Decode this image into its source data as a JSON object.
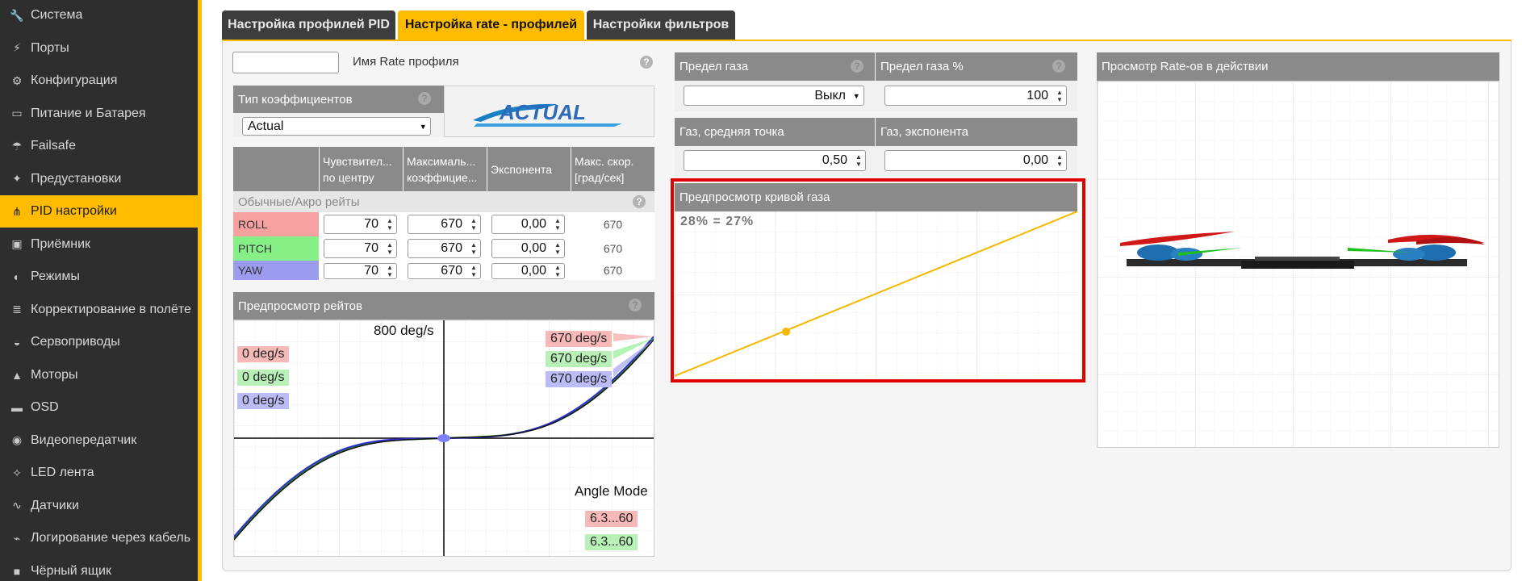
{
  "sidebar": {
    "items": [
      {
        "label": "Система",
        "icon": "wrench-icon"
      },
      {
        "label": "Порты",
        "icon": "plug-icon"
      },
      {
        "label": "Конфигурация",
        "icon": "gear-icon"
      },
      {
        "label": "Питание и Батарея",
        "icon": "battery-icon"
      },
      {
        "label": "Failsafe",
        "icon": "parachute-icon"
      },
      {
        "label": "Предустановки",
        "icon": "magic-wand-icon"
      },
      {
        "label": "PID настройки",
        "icon": "network-icon",
        "active": true
      },
      {
        "label": "Приёмник",
        "icon": "radio-icon"
      },
      {
        "label": "Режимы",
        "icon": "toggle-icon"
      },
      {
        "label": "Корректирование в полёте",
        "icon": "sliders-icon"
      },
      {
        "label": "Сервоприводы",
        "icon": "servo-icon"
      },
      {
        "label": "Моторы",
        "icon": "motor-icon"
      },
      {
        "label": "OSD",
        "icon": "osd-icon"
      },
      {
        "label": "Видеопередатчик",
        "icon": "broadcast-icon"
      },
      {
        "label": "LED лента",
        "icon": "led-icon"
      },
      {
        "label": "Датчики",
        "icon": "pulse-icon"
      },
      {
        "label": "Логирование через кабель",
        "icon": "cable-icon"
      },
      {
        "label": "Чёрный ящик",
        "icon": "blackbox-icon"
      }
    ]
  },
  "tabs": [
    {
      "label": "Настройка профилей PID"
    },
    {
      "label": "Настройка rate - профилей",
      "active": true
    },
    {
      "label": "Настройки фильтров"
    }
  ],
  "profile": {
    "name_value": "",
    "name_label": "Имя Rate профиля"
  },
  "coef": {
    "header": "Тип коэффициентов",
    "selected": "Actual",
    "logo_text": "ACTUAL"
  },
  "rates_table": {
    "columns": [
      "Чувствител... по центру",
      "Максималь... коэффицие...",
      "Экспонента",
      "Макс. скор. [град/сек]"
    ],
    "col_line1": [
      "Чувствител...",
      "Максималь...",
      "Экспонента",
      "Макс. скор."
    ],
    "col_line2": [
      "по центру",
      "коэффицие...",
      "",
      "[град/сек]"
    ],
    "section_label": "Обычные/Акро рейты",
    "rows": [
      {
        "axis": "ROLL",
        "center": "70",
        "max": "670",
        "expo": "0,00",
        "maxrate": "670",
        "color": "#f7a0a0"
      },
      {
        "axis": "PITCH",
        "center": "70",
        "max": "670",
        "expo": "0,00",
        "maxrate": "670",
        "color": "#86f086"
      },
      {
        "axis": "YAW",
        "center": "70",
        "max": "670",
        "expo": "0,00",
        "maxrate": "670",
        "color": "#9b9bf0"
      }
    ]
  },
  "rates_preview": {
    "title": "Предпросмотр рейтов",
    "top_label": "800 deg/s",
    "current": [
      "0 deg/s",
      "0 deg/s",
      "0 deg/s"
    ],
    "max": [
      "670 deg/s",
      "670 deg/s",
      "670 deg/s"
    ],
    "mode_label": "Angle Mode",
    "mode_values": [
      "6.3...60",
      "6.3...60"
    ]
  },
  "throttle": {
    "limit_label": "Предел газа",
    "limit_value": "Выкл",
    "limit_pct_label": "Предел газа %",
    "limit_pct_value": "100",
    "mid_label": "Газ, средняя точка",
    "mid_value": "0,50",
    "expo_label": "Газ, экспонента",
    "expo_value": "0,00"
  },
  "throttle_preview": {
    "title": "Предпросмотр кривой газа",
    "readout": "28% = 27%"
  },
  "model_preview": {
    "title": "Просмотр Rate-ов в действии"
  },
  "colors": {
    "accent": "#ffbb00",
    "highlight": "#e00000",
    "curve": "#f5b800"
  }
}
